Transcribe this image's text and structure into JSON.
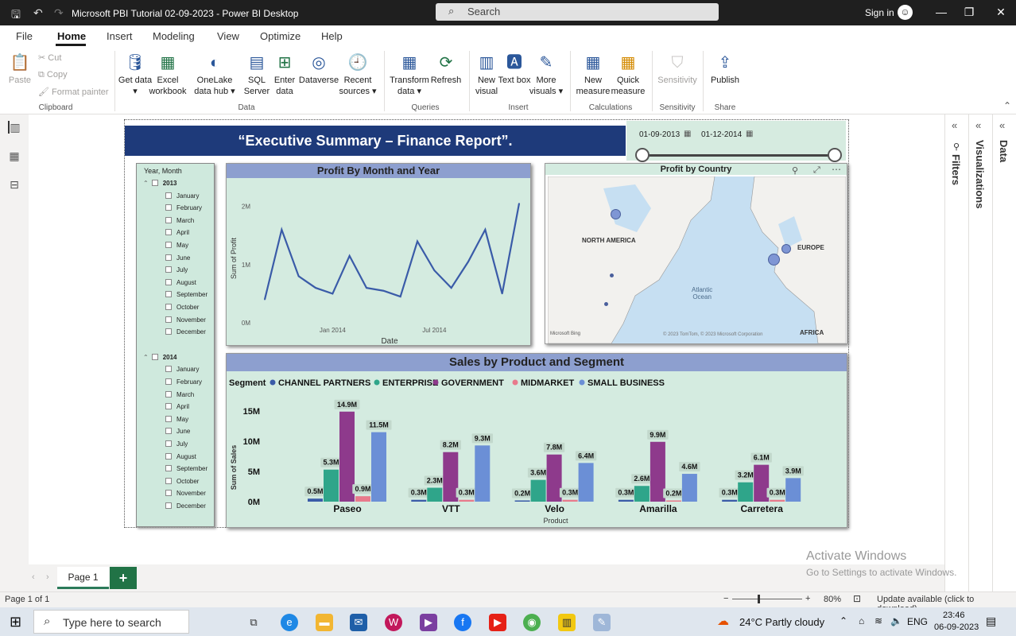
{
  "titlebar": {
    "app_title": "Microsoft PBI Tutorial 02-09-2023 - Power BI Desktop",
    "search_placeholder": "Search",
    "sign_in": "Sign in"
  },
  "menu": [
    "File",
    "Home",
    "Insert",
    "Modeling",
    "View",
    "Optimize",
    "Help"
  ],
  "ribbon": {
    "clipboard": {
      "paste": "Paste",
      "cut": "Cut",
      "copy": "Copy",
      "format_painter": "Format painter",
      "label": "Clipboard"
    },
    "data": {
      "get_data": "Get data",
      "excel": "Excel workbook",
      "onelake": "OneLake data hub",
      "sql": "SQL Server",
      "enter_data": "Enter data",
      "dataverse": "Dataverse",
      "recent": "Recent sources",
      "label": "Data"
    },
    "queries": {
      "transform": "Transform data",
      "refresh": "Refresh",
      "label": "Queries"
    },
    "insert": {
      "new_visual": "New visual",
      "text_box": "Text box",
      "more_visuals": "More visuals",
      "label": "Insert"
    },
    "calculations": {
      "new_measure": "New measure",
      "quick_measure": "Quick measure",
      "label": "Calculations"
    },
    "sensitivity": {
      "sensitivity": "Sensitivity",
      "label": "Sensitivity"
    },
    "share": {
      "publish": "Publish",
      "label": "Share"
    }
  },
  "report": {
    "header": "“Executive Summary – Finance Report”.",
    "date_slicer": {
      "start": "01-09-2013",
      "end": "01-12-2014"
    },
    "year_month_slicer": {
      "title": "Year, Month",
      "years": [
        {
          "year": "2013",
          "months": [
            "January",
            "February",
            "March",
            "April",
            "May",
            "June",
            "July",
            "August",
            "September",
            "October",
            "November",
            "December"
          ]
        },
        {
          "year": "2014",
          "months": [
            "January",
            "February",
            "March",
            "April",
            "May",
            "June",
            "July",
            "August",
            "September",
            "October",
            "November",
            "December"
          ]
        }
      ]
    },
    "line_chart": {
      "title": "Profit By Month and Year"
    },
    "map": {
      "title": "Profit by Country",
      "labels": {
        "north_america": "NORTH AMERICA",
        "europe": "EUROPE",
        "ocean": "Atlantic\nOcean",
        "africa": "AFRICA"
      },
      "credits": {
        "bing": "Microsoft Bing",
        "copyright": "© 2023 TomTom, © 2023 Microsoft Corporation"
      }
    },
    "bar_chart": {
      "title": "Sales by Product and Segment"
    }
  },
  "chart_data": [
    {
      "type": "line",
      "title": "Profit By Month and Year",
      "xlabel": "Date",
      "ylabel": "Sum of Profit",
      "x_ticks": [
        "Jan 2014",
        "Jul 2014"
      ],
      "y_ticks": [
        "0M",
        "1M",
        "2M"
      ],
      "ylim": [
        0,
        2.2
      ],
      "x": [
        "Sep 2013",
        "Oct 2013",
        "Nov 2013",
        "Dec 2013",
        "Jan 2014",
        "Feb 2014",
        "Mar 2014",
        "Apr 2014",
        "May 2014",
        "Jun 2014",
        "Jul 2014",
        "Aug 2014",
        "Sep 2014",
        "Oct 2014",
        "Nov 2014",
        "Dec 2014"
      ],
      "values": [
        0.4,
        1.6,
        0.8,
        0.6,
        0.5,
        1.15,
        0.6,
        0.55,
        0.45,
        1.4,
        0.9,
        0.6,
        1.05,
        1.6,
        0.5,
        2.05
      ],
      "color": "#3a5ba8"
    },
    {
      "type": "bar",
      "title": "Sales by Product and Segment",
      "xlabel": "Product",
      "ylabel": "Sum of Sales",
      "legend_title": "Segment",
      "legend_position": "top-left",
      "y_ticks": [
        "0M",
        "5M",
        "10M",
        "15M"
      ],
      "ylim": [
        0,
        15
      ],
      "categories": [
        "Paseo",
        "VTT",
        "Velo",
        "Amarilla",
        "Carretera"
      ],
      "series": [
        {
          "name": "CHANNEL PARTNERS",
          "color": "#3a5ba8",
          "values": [
            0.5,
            0.3,
            0.2,
            0.3,
            0.3
          ],
          "labels": [
            "0.5M",
            "0.3M",
            "0.2M",
            "0.3M",
            "0.3M"
          ]
        },
        {
          "name": "ENTERPRISE",
          "color": "#2fa58a",
          "values": [
            5.3,
            2.3,
            3.6,
            2.6,
            3.2
          ],
          "labels": [
            "5.3M",
            "2.3M",
            "3.6M",
            "2.6M",
            "3.2M"
          ]
        },
        {
          "name": "GOVERNMENT",
          "color": "#8e3a8c",
          "values": [
            14.9,
            8.2,
            7.8,
            9.9,
            6.1
          ],
          "labels": [
            "14.9M",
            "8.2M",
            "7.8M",
            "9.9M",
            "6.1M"
          ]
        },
        {
          "name": "MIDMARKET",
          "color": "#e87a8c",
          "values": [
            0.9,
            0.3,
            0.3,
            0.2,
            0.3
          ],
          "labels": [
            "0.9M",
            "0.3M",
            "0.3M",
            "0.2M",
            "0.3M"
          ]
        },
        {
          "name": "SMALL BUSINESS",
          "color": "#6b8fd6",
          "values": [
            11.5,
            9.3,
            6.4,
            4.6,
            3.9
          ],
          "labels": [
            "11.5M",
            "9.3M",
            "6.4M",
            "4.6M",
            "3.9M"
          ]
        }
      ]
    }
  ],
  "panes": {
    "filters": "Filters",
    "visualizations": "Visualizations",
    "data": "Data"
  },
  "pages": {
    "tab": "Page 1",
    "add": "+"
  },
  "status": {
    "page": "Page 1 of 1",
    "zoom": "80%",
    "update": "Update available (click to download)"
  },
  "watermark": {
    "line1": "Activate Windows",
    "line2": "Go to Settings to activate Windows."
  },
  "taskbar": {
    "search": "Type here to search",
    "weather": "24°C  Partly cloudy",
    "lang": "ENG",
    "time": "23:46",
    "date": "06-09-2023"
  }
}
